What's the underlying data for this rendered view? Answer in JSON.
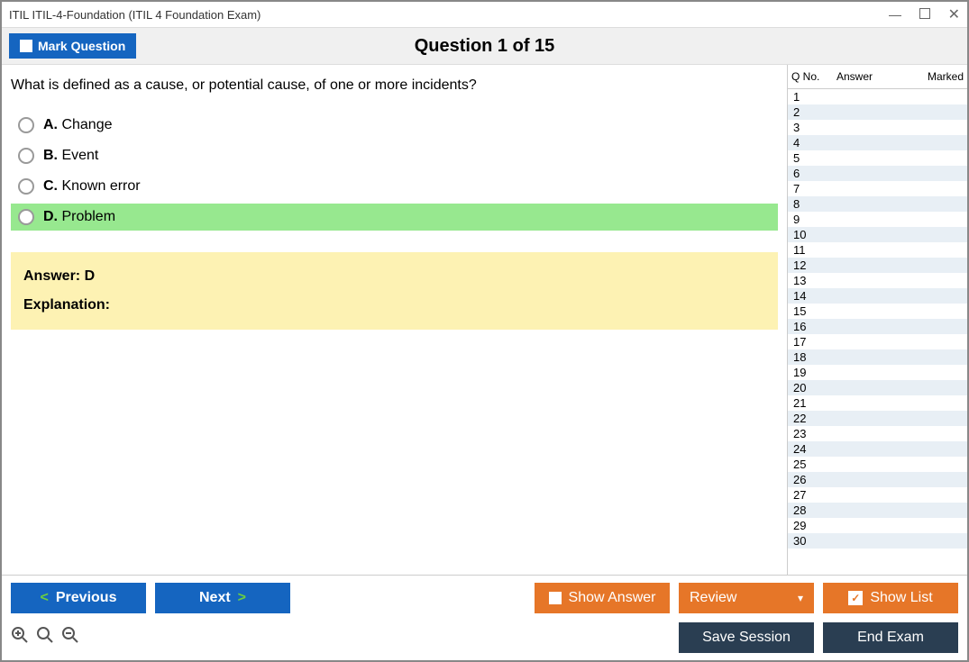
{
  "window": {
    "title": "ITIL ITIL-4-Foundation (ITIL 4 Foundation Exam)"
  },
  "header": {
    "mark_label": "Mark Question",
    "question_heading": "Question 1 of 15"
  },
  "question": {
    "text": "What is defined as a cause, or potential cause, of one or more incidents?",
    "options": [
      {
        "letter": "A.",
        "text": "Change",
        "correct": false
      },
      {
        "letter": "B.",
        "text": "Event",
        "correct": false
      },
      {
        "letter": "C.",
        "text": "Known error",
        "correct": false
      },
      {
        "letter": "D.",
        "text": "Problem",
        "correct": true
      }
    ],
    "answer_line": "Answer: D",
    "explanation_label": "Explanation:"
  },
  "sidepanel": {
    "col_qno": "Q No.",
    "col_answer": "Answer",
    "col_marked": "Marked",
    "rows": [
      1,
      2,
      3,
      4,
      5,
      6,
      7,
      8,
      9,
      10,
      11,
      12,
      13,
      14,
      15,
      16,
      17,
      18,
      19,
      20,
      21,
      22,
      23,
      24,
      25,
      26,
      27,
      28,
      29,
      30
    ]
  },
  "buttons": {
    "previous": "Previous",
    "next": "Next",
    "show_answer": "Show Answer",
    "review": "Review",
    "show_list": "Show List",
    "save_session": "Save Session",
    "end_exam": "End Exam"
  }
}
